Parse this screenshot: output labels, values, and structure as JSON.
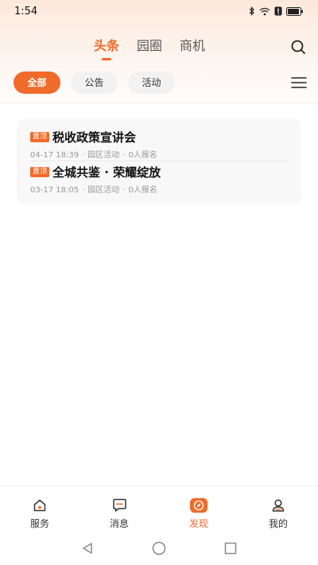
{
  "status_bar": {
    "time": "1:54"
  },
  "top_nav": {
    "tabs": [
      {
        "label": "头条",
        "active": true
      },
      {
        "label": "园圈",
        "active": false
      },
      {
        "label": "商机",
        "active": false
      }
    ]
  },
  "filters": {
    "chips": [
      {
        "label": "全部",
        "active": true
      },
      {
        "label": "公告",
        "active": false
      },
      {
        "label": "活动",
        "active": false
      }
    ]
  },
  "news": [
    {
      "tag": "置顶",
      "title": "税收政策宣讲会",
      "date": "04-17 18:39",
      "category": "园区活动",
      "signups": "0人报名"
    },
    {
      "tag": "置顶",
      "title": "全城共鉴 · 荣耀绽放",
      "date": "03-17 18:05",
      "category": "园区活动",
      "signups": "0人报名"
    }
  ],
  "bottom_nav": {
    "items": [
      {
        "label": "服务",
        "icon": "home-icon",
        "active": false
      },
      {
        "label": "消息",
        "icon": "message-icon",
        "active": false
      },
      {
        "label": "发现",
        "icon": "compass-icon",
        "active": true
      },
      {
        "label": "我的",
        "icon": "user-icon",
        "active": false
      }
    ]
  },
  "colors": {
    "accent": "#f06a2a",
    "card_bg": "#f8f8f8"
  }
}
